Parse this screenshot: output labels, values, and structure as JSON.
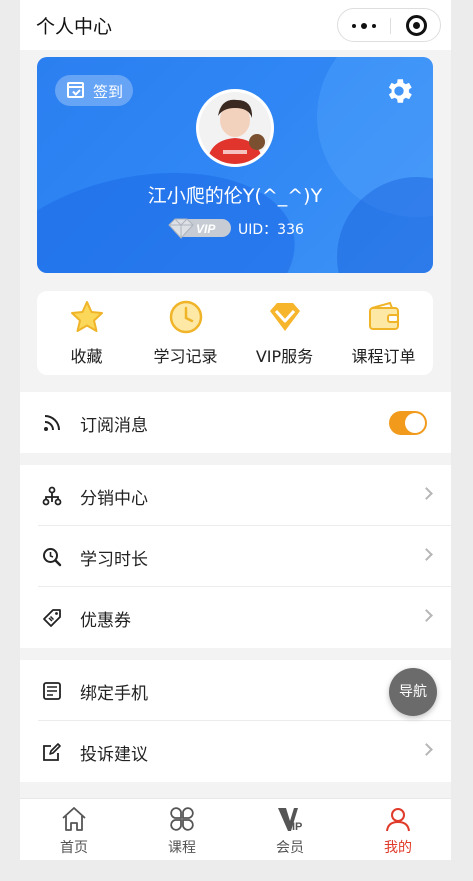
{
  "header": {
    "title": "个人中心"
  },
  "profile": {
    "signin_label": "签到",
    "username": "江小爬的伦Y(^_^)Y",
    "vip_label": "VIP",
    "uid_text": "UID：336"
  },
  "quick_menu": [
    {
      "label": "收藏",
      "icon": "star-icon"
    },
    {
      "label": "学习记录",
      "icon": "clock-icon"
    },
    {
      "label": "VIP服务",
      "icon": "diamond-icon"
    },
    {
      "label": "课程订单",
      "icon": "wallet-icon"
    }
  ],
  "subscribe": {
    "label": "订阅消息",
    "enabled": true
  },
  "group2": [
    {
      "label": "分销中心",
      "icon": "distribution-icon"
    },
    {
      "label": "学习时长",
      "icon": "search-time-icon"
    },
    {
      "label": "优惠券",
      "icon": "coupon-icon"
    }
  ],
  "group3": [
    {
      "label": "绑定手机",
      "icon": "phone-bind-icon"
    },
    {
      "label": "投诉建议",
      "icon": "feedback-icon"
    }
  ],
  "float_nav": {
    "label": "导航"
  },
  "tabbar": [
    {
      "label": "首页",
      "icon": "home-icon",
      "active": false
    },
    {
      "label": "课程",
      "icon": "course-icon",
      "active": false
    },
    {
      "label": "会员",
      "icon": "vip-icon",
      "active": false
    },
    {
      "label": "我的",
      "icon": "user-icon",
      "active": true
    }
  ],
  "colors": {
    "accent": "#e03a2a",
    "brand_blue": "#2f86f4",
    "toggle_on": "#f19a1c",
    "icon_gold": "#f0b429"
  }
}
